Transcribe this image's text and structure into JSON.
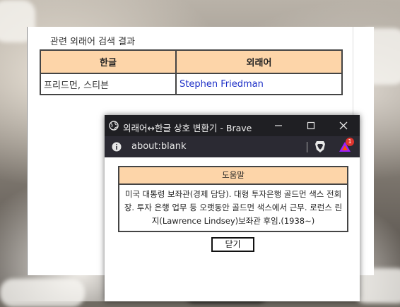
{
  "main": {
    "section_title": "관련 외래어 검색 결과",
    "table": {
      "headers": [
        "한글",
        "외래어"
      ],
      "rows": [
        {
          "korean": "프리드먼, 스티븐",
          "foreign": "Stephen Friedman"
        }
      ]
    }
  },
  "popup": {
    "window_title": "외래어↔한글 상호 변환기 - Brave",
    "address": "about:blank",
    "extension_badge": "1",
    "help": {
      "heading": "도움말",
      "body": "미국 대통령 보좌관(경제 담당). 대형 투자은행 골드먼 색스 전회장. 투자 은행 업무 등 오랫동안 골드먼 색스에서 근무. 로런스 린지(Lawrence Lindsey)보좌관 후임.(1938∼)"
    },
    "close_label": "닫기"
  },
  "colors": {
    "header_bg": "#fdd5a9",
    "link": "#1d2fc7",
    "titlebar_bg": "#1f1f23",
    "addressbar_bg": "#2b2a33"
  }
}
